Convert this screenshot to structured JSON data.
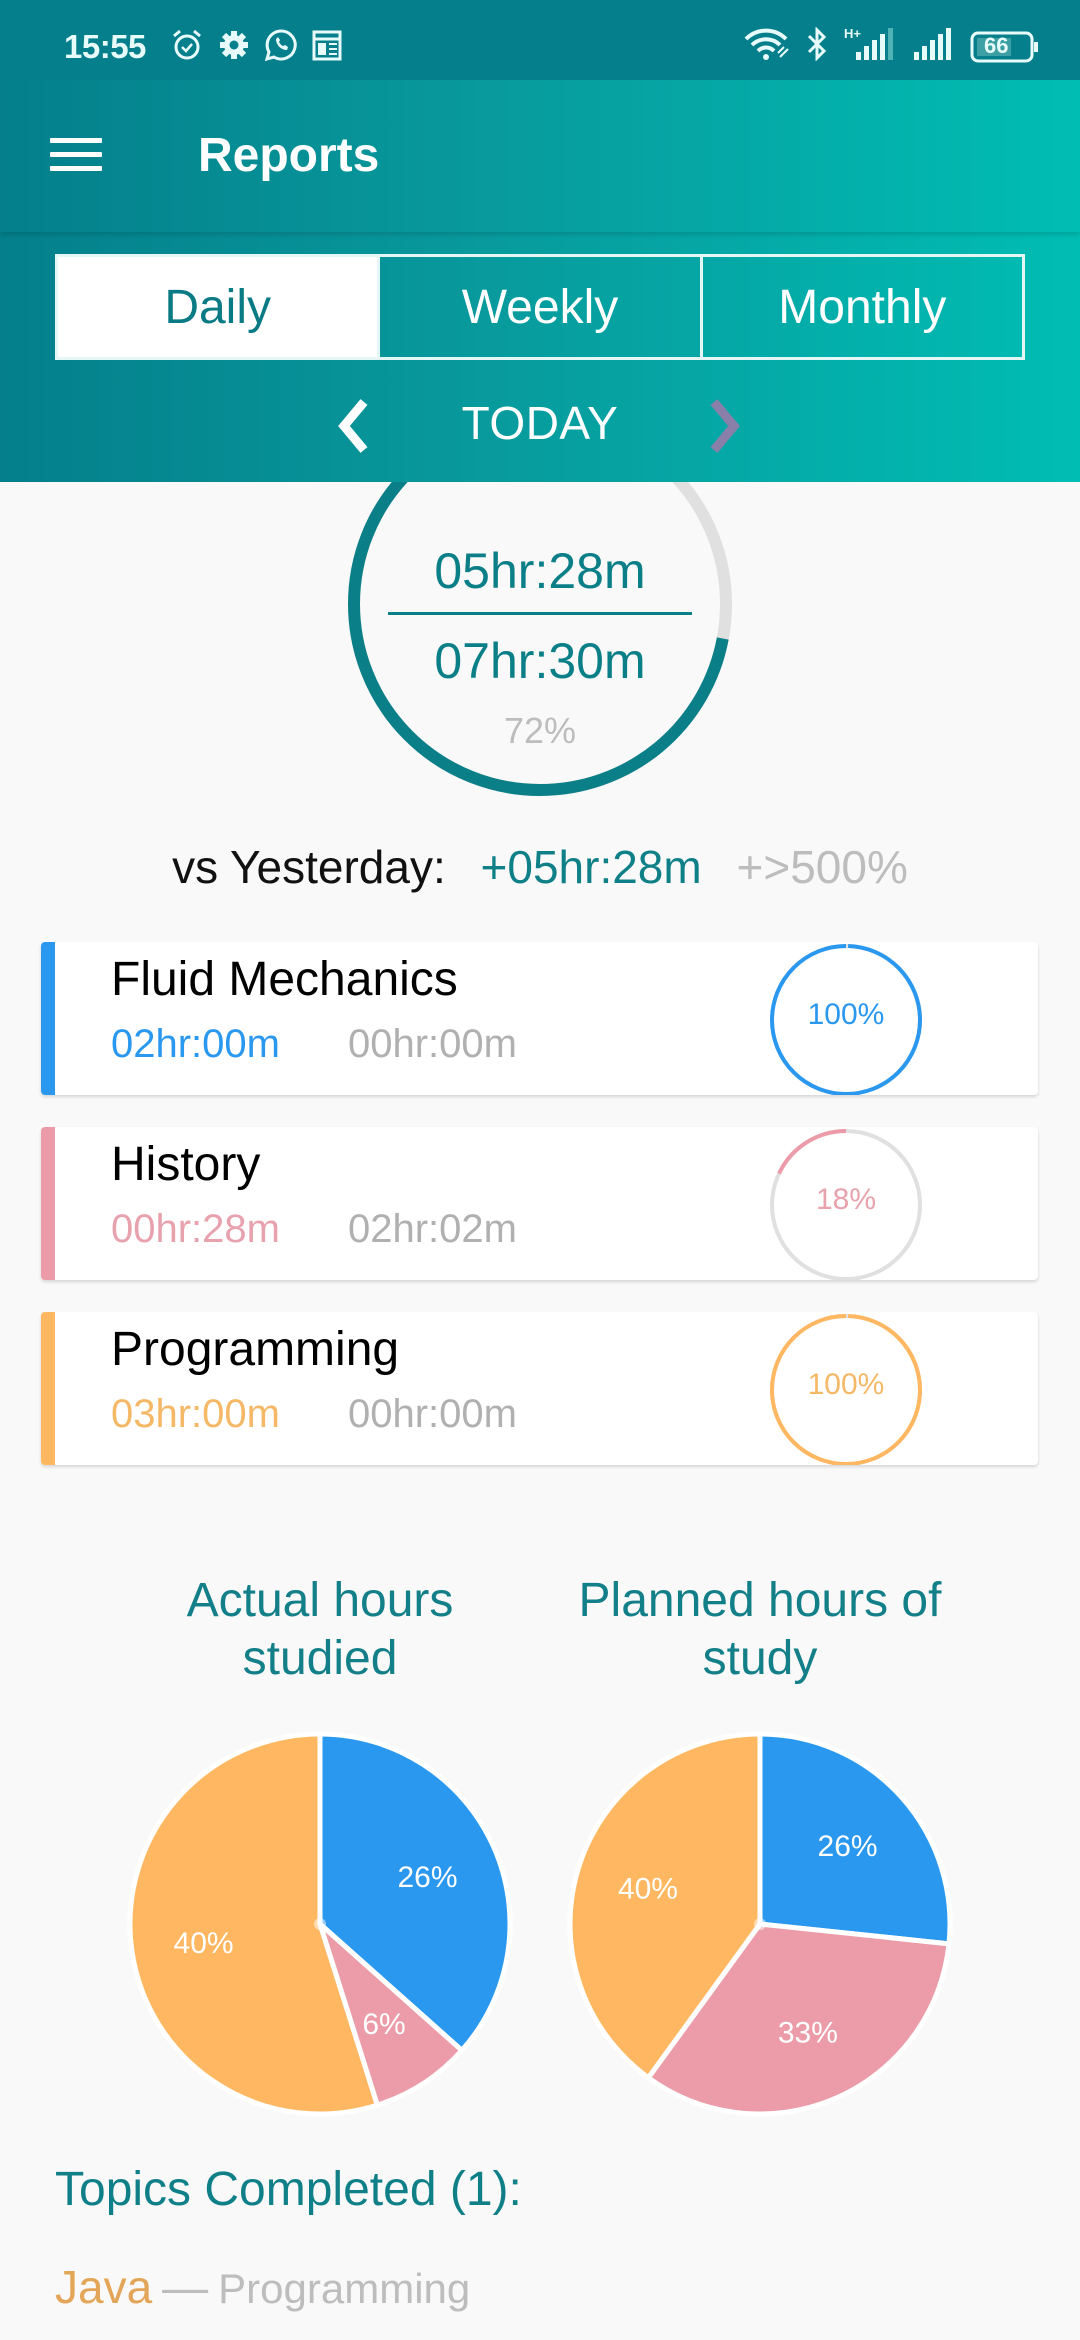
{
  "status_bar": {
    "time": "15:55",
    "left_icons": [
      "alarm-icon",
      "gear-icon",
      "whatsapp-icon",
      "calendar-icon"
    ],
    "right_icons": [
      "wifi-icon",
      "bluetooth-icon",
      "signal-h-plus-icon",
      "signal-icon",
      "battery-icon"
    ],
    "network_label": "H+",
    "battery": "66"
  },
  "header": {
    "title": "Reports",
    "tabs": [
      {
        "label": "Daily",
        "active": true
      },
      {
        "label": "Weekly",
        "active": false
      },
      {
        "label": "Monthly",
        "active": false
      }
    ],
    "period_label": "TODAY"
  },
  "colors": {
    "primary": "#0b7f88",
    "fluid_mechanics": "#2b98f0",
    "history": "#ec9ca8",
    "programming": "#ffb861",
    "ring_track": "#e0e0e0"
  },
  "summary": {
    "actual": "05hr:28m",
    "planned": "07hr:30m",
    "percent_label": "72%",
    "progress": 0.72,
    "vs_label": "vs Yesterday:",
    "vs_delta": "+05hr:28m",
    "vs_percent": "+>500%"
  },
  "subjects": [
    {
      "name": "Fluid Mechanics",
      "actual": "02hr:00m",
      "remaining": "00hr:00m",
      "percent_label": "100%",
      "progress": 1.0,
      "color": "#2b98f0"
    },
    {
      "name": "History",
      "actual": "00hr:28m",
      "remaining": "02hr:02m",
      "percent_label": "18%",
      "progress": 0.18,
      "color": "#ec9ca8"
    },
    {
      "name": "Programming",
      "actual": "03hr:00m",
      "remaining": "00hr:00m",
      "percent_label": "100%",
      "progress": 1.0,
      "color": "#ffb861"
    }
  ],
  "chart_data": [
    {
      "type": "pie",
      "title": "Actual hours studied",
      "categories": [
        "Fluid Mechanics",
        "History",
        "Programming"
      ],
      "values": [
        120,
        28,
        180
      ],
      "unit": "minutes",
      "labels": [
        "26%",
        "6%",
        "40%"
      ],
      "colors": [
        "#2b98f0",
        "#ec9ca8",
        "#ffb861"
      ]
    },
    {
      "type": "pie",
      "title": "Planned hours of study",
      "categories": [
        "Fluid Mechanics",
        "History",
        "Programming"
      ],
      "values": [
        120,
        150,
        180
      ],
      "unit": "minutes",
      "labels": [
        "26%",
        "33%",
        "40%"
      ],
      "colors": [
        "#2b98f0",
        "#ec9ca8",
        "#ffb861"
      ]
    }
  ],
  "charts_titles": {
    "actual_line1": "Actual hours",
    "actual_line2": "studied",
    "planned_line1": "Planned hours of",
    "planned_line2": "study"
  },
  "topics": {
    "title": "Topics Completed (1):",
    "items": [
      {
        "name": "Java",
        "separator": "—",
        "subject": "Programming"
      }
    ]
  }
}
